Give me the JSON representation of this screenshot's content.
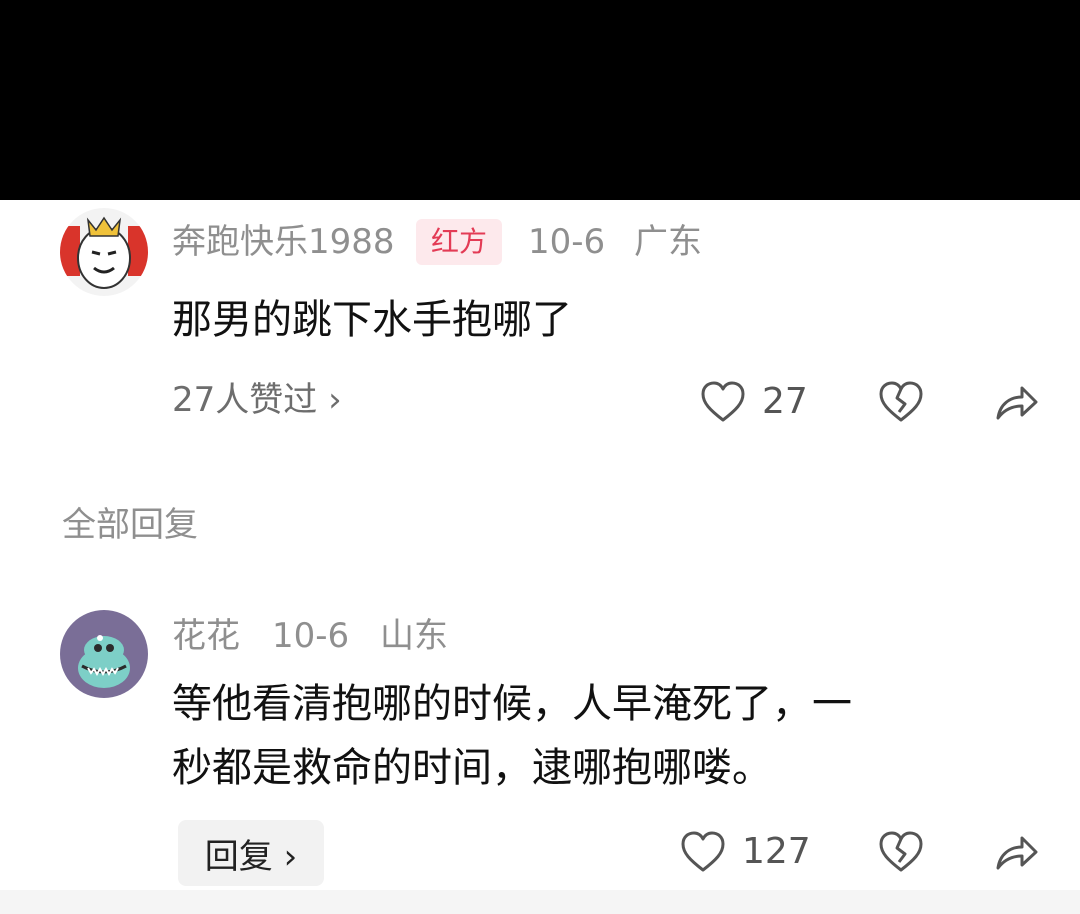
{
  "main_comment": {
    "username": "奔跑快乐1988",
    "badge": "红方",
    "date": "10-6",
    "location": "广东",
    "text": "那男的跳下水手抱哪了",
    "likers_link": "27人赞过 ›",
    "like_count": "27"
  },
  "replies_section": {
    "title": "全部回复"
  },
  "reply": {
    "username": "花花",
    "date": "10-6",
    "location": "山东",
    "text_line1": "等他看清抱哪的时候，人早淹死了，一",
    "text_line2": "秒都是救命的时间，逮哪抱哪喽。",
    "reply_button": "回复 ›",
    "like_count": "127"
  },
  "colors": {
    "badge_bg": "#fde9ec",
    "badge_text": "#e33b55",
    "meta": "#8f8f8f",
    "top_bar": "#000000"
  },
  "icons": [
    "heart-icon",
    "broken-heart-icon",
    "share-icon"
  ]
}
